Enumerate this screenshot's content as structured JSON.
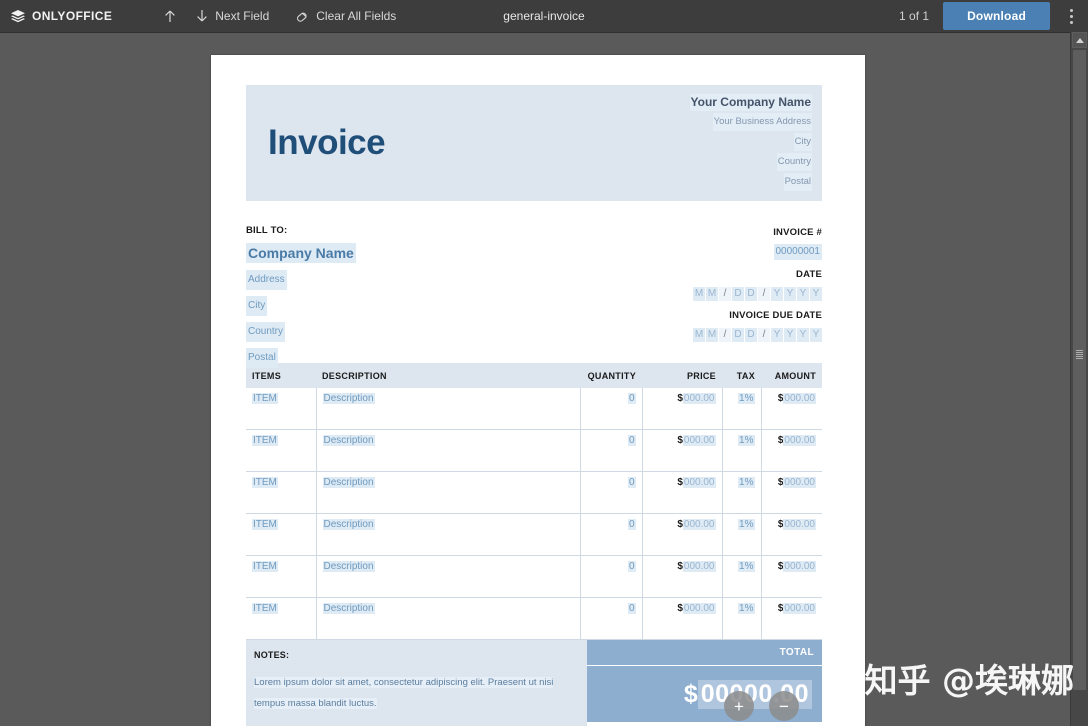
{
  "toolbar": {
    "brand": "ONLYOFFICE",
    "brand_icon": "layers-icon",
    "prev_field_icon": "arrow-up-icon",
    "next_field_icon": "arrow-down-icon",
    "next_field_label": "Next Field",
    "clear_icon": "eraser-icon",
    "clear_label": "Clear All Fields",
    "doc_title": "general-invoice",
    "page_count": "1 of 1",
    "download_label": "Download",
    "more_icon": "kebab-menu-icon",
    "accent": "#4a80b4",
    "bg": "#3d3d3d"
  },
  "invoice": {
    "title": "Invoice",
    "company": {
      "name": "Your Company Name",
      "address": "Your Business Address",
      "city": "City",
      "country": "Country",
      "postal": "Postal"
    },
    "bill_to": {
      "label": "BILL TO:",
      "company": "Company Name",
      "address": "Address",
      "city": "City",
      "country": "Country",
      "postal": "Postal"
    },
    "meta": {
      "invoice_no_label": "INVOICE #",
      "invoice_no": "00000001",
      "date_label": "DATE",
      "date_cells": [
        "M",
        "M",
        "/",
        "D",
        "D",
        "/",
        "Y",
        "Y",
        "Y",
        "Y"
      ],
      "due_date_label": "INVOICE DUE DATE",
      "due_date_cells": [
        "M",
        "M",
        "/",
        "D",
        "D",
        "/",
        "Y",
        "Y",
        "Y",
        "Y"
      ]
    },
    "table": {
      "headers": [
        "ITEMS",
        "DESCRIPTION",
        "QUANTITY",
        "PRICE",
        "TAX",
        "AMOUNT"
      ],
      "rows": [
        {
          "item": "ITEM",
          "description": "Description",
          "quantity": "0",
          "price": "000.00",
          "tax": "1%",
          "amount": "000.00"
        },
        {
          "item": "ITEM",
          "description": "Description",
          "quantity": "0",
          "price": "000.00",
          "tax": "1%",
          "amount": "000.00"
        },
        {
          "item": "ITEM",
          "description": "Description",
          "quantity": "0",
          "price": "000.00",
          "tax": "1%",
          "amount": "000.00"
        },
        {
          "item": "ITEM",
          "description": "Description",
          "quantity": "0",
          "price": "000.00",
          "tax": "1%",
          "amount": "000.00"
        },
        {
          "item": "ITEM",
          "description": "Description",
          "quantity": "0",
          "price": "000.00",
          "tax": "1%",
          "amount": "000.00"
        },
        {
          "item": "ITEM",
          "description": "Description",
          "quantity": "0",
          "price": "000.00",
          "tax": "1%",
          "amount": "000.00"
        }
      ],
      "currency": "$",
      "add_row_label": "+",
      "remove_row_label": "−"
    },
    "notes": {
      "label": "NOTES:",
      "text": "Lorem ipsum dolor sit amet, consectetur adipiscing elit. Praesent ut nisi tempus massa blandit luctus."
    },
    "total": {
      "label": "TOTAL",
      "currency": "$",
      "value": "00000.00"
    }
  },
  "watermark": "知乎 @埃琳娜"
}
